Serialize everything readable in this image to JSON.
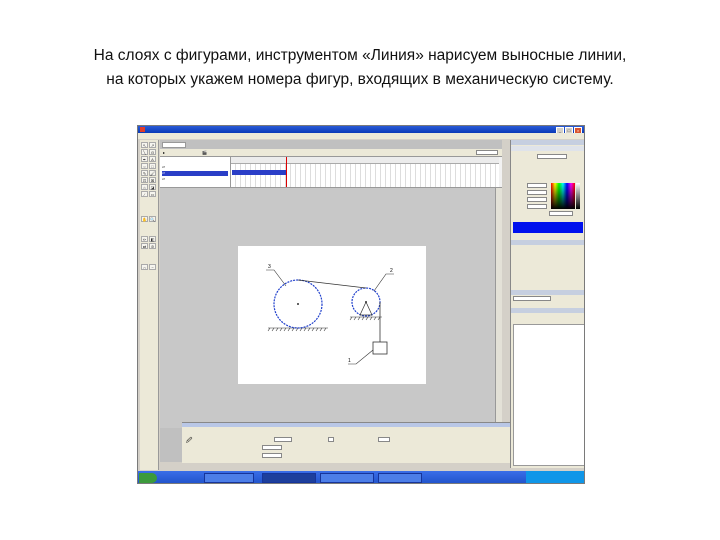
{
  "caption": {
    "line1": "На слоях с фигурами, инструментом «Линия» нарисуем выносные линии,",
    "line2": "на которых укажем номера фигур, входящих в механическую систему."
  },
  "colors": {
    "titlebar": "#0a3ab8",
    "stage_line": "#1f3fcc",
    "swatch": "#0011ee",
    "taskbar": "#1e50c8"
  },
  "figure_labels": [
    "3",
    "2",
    "1"
  ]
}
